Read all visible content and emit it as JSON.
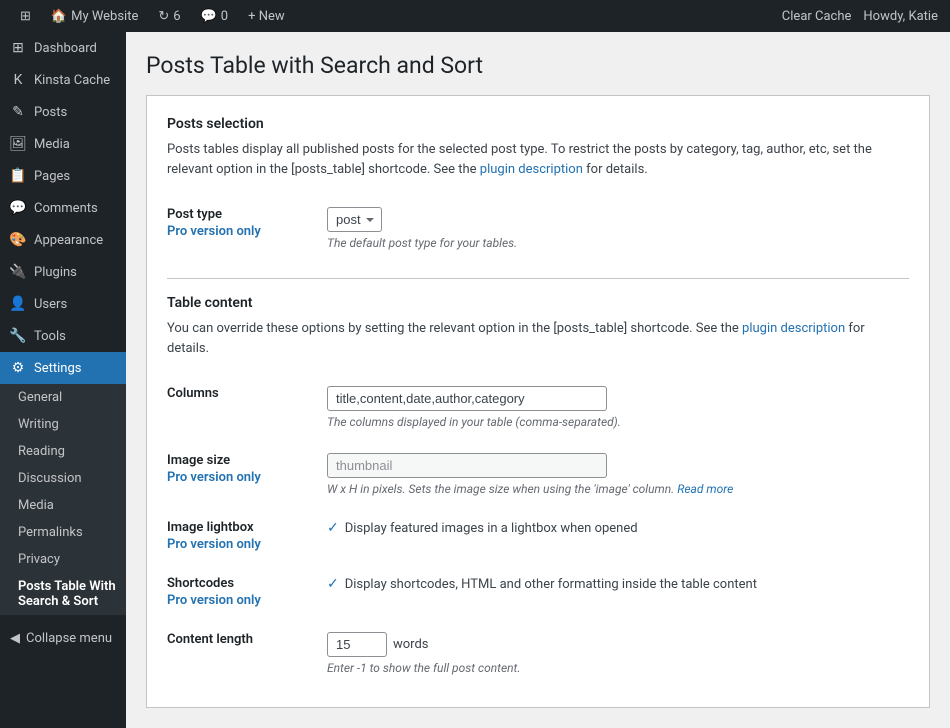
{
  "adminBar": {
    "wpLogo": "⊞",
    "siteName": "My Website",
    "updates": "6",
    "comments": "0",
    "newLabel": "+ New",
    "clearCache": "Clear Cache",
    "howdy": "Howdy, Katie"
  },
  "sidebar": {
    "items": [
      {
        "id": "dashboard",
        "label": "Dashboard",
        "icon": "⊞"
      },
      {
        "id": "kinsta-cache",
        "label": "Kinsta Cache",
        "icon": "K"
      },
      {
        "id": "posts",
        "label": "Posts",
        "icon": "📄"
      },
      {
        "id": "media",
        "label": "Media",
        "icon": "🖼"
      },
      {
        "id": "pages",
        "label": "Pages",
        "icon": "📋"
      },
      {
        "id": "comments",
        "label": "Comments",
        "icon": "💬"
      },
      {
        "id": "appearance",
        "label": "Appearance",
        "icon": "🎨"
      },
      {
        "id": "plugins",
        "label": "Plugins",
        "icon": "🔌"
      },
      {
        "id": "users",
        "label": "Users",
        "icon": "👤"
      },
      {
        "id": "tools",
        "label": "Tools",
        "icon": "🔧"
      },
      {
        "id": "settings",
        "label": "Settings",
        "icon": "⚙"
      }
    ],
    "settingsSubmenu": [
      {
        "id": "general",
        "label": "General"
      },
      {
        "id": "writing",
        "label": "Writing"
      },
      {
        "id": "reading",
        "label": "Reading"
      },
      {
        "id": "discussion",
        "label": "Discussion"
      },
      {
        "id": "media",
        "label": "Media"
      },
      {
        "id": "permalinks",
        "label": "Permalinks"
      },
      {
        "id": "privacy",
        "label": "Privacy"
      },
      {
        "id": "posts-table",
        "label": "Posts Table With Search & Sort"
      }
    ],
    "collapseLabel": "Collapse menu"
  },
  "page": {
    "title": "Posts Table with Search and Sort",
    "postsSelection": {
      "heading": "Posts selection",
      "description": "Posts tables display all published posts for the selected post type. To restrict the posts by category, tag, author, etc, set the relevant option in the [posts_table] shortcode. See the",
      "linkText": "plugin description",
      "descriptionSuffix": "for details."
    },
    "postType": {
      "label": "Post type",
      "proVersionLabel": "Pro version only",
      "value": "post",
      "helpText": "The default post type for your tables."
    },
    "tableContent": {
      "heading": "Table content",
      "description": "You can override these options by setting the relevant option in the [posts_table] shortcode. See the",
      "linkText": "plugin description",
      "descriptionSuffix": "for details."
    },
    "columns": {
      "label": "Columns",
      "value": "title,content,date,author,category",
      "helpText": "The columns displayed in your table (comma-separated)."
    },
    "imageSize": {
      "label": "Image size",
      "proVersionLabel": "Pro version only",
      "placeholder": "thumbnail",
      "helpText": "W x H in pixels. Sets the image size when using the 'image' column.",
      "readMoreLabel": "Read more"
    },
    "imageLightbox": {
      "label": "Image lightbox",
      "proVersionLabel": "Pro version only",
      "checkText": "Display featured images in a lightbox when opened"
    },
    "shortcodes": {
      "label": "Shortcodes",
      "proVersionLabel": "Pro version only",
      "checkText": "Display shortcodes, HTML and other formatting inside the table content"
    },
    "contentLength": {
      "label": "Content length",
      "value": "15",
      "unit": "words",
      "helpText": "Enter -1 to show the full post content."
    }
  }
}
